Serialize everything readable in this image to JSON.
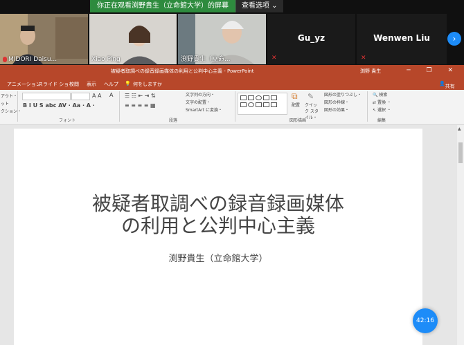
{
  "share_bar": {
    "message": "你正在观看渕野貴生（立命館大学）的屏幕",
    "view_options": "查看选项",
    "accent": "#2e8b3e"
  },
  "participants": [
    {
      "name": "MIDORI Daisu...",
      "video": true
    },
    {
      "name": "Xiao Ping",
      "video": true
    },
    {
      "name": "渕野貴生（立命...",
      "video": true
    },
    {
      "name": "Gu_yz",
      "video": false
    },
    {
      "name": "Wenwen Liu",
      "video": false
    }
  ],
  "next_icon": "chevron-right-icon",
  "ppt": {
    "window_title": "被疑者取調べの録音録画媒体の利用と公判中心主義 - PowerPoint",
    "user": "渕野 貴生",
    "window_controls": "─ ❐ ✕",
    "menu": [
      "アニメーション",
      "スライド ショー",
      "校閲",
      "表示",
      "ヘルプ",
      "何をしますか"
    ],
    "share_label": "共有",
    "ribbon": {
      "clipboard_items": [
        "アウト・",
        "ット",
        "クション・"
      ],
      "font_group": "フォント",
      "paragraph_group": "段落",
      "paragraph_items": [
        "文字列の方向・",
        "文字の配置・",
        "SmartArt に変換・"
      ],
      "drawing_group": "図形描画",
      "arrange_label": "配置",
      "quick_style": "クイック スタイル・",
      "drawing_items": [
        "図形の塗りつぶし・",
        "図形の枠線・",
        "図形の効果・"
      ],
      "edit_group": "編集",
      "edit_items": [
        "検索",
        "置換 ・",
        "選択 ・"
      ],
      "brand_color": "#b7472a"
    },
    "slide": {
      "title_line1": "被疑者取調べの録音録画媒体",
      "title_line2": "の利用と公判中心主義",
      "subtitle": "渕野貴生（立命館大学）"
    }
  },
  "timer": "42:16"
}
